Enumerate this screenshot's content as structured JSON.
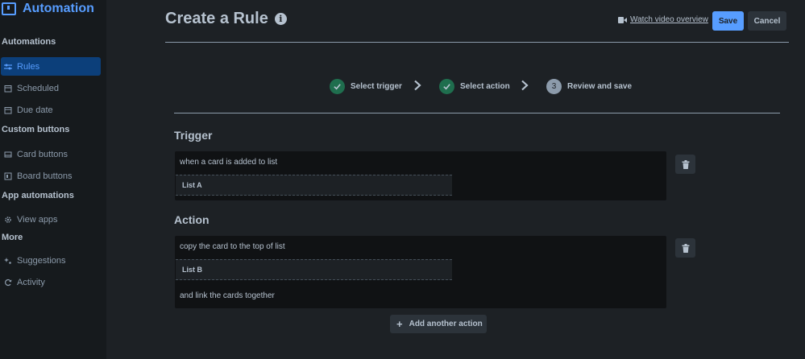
{
  "app": {
    "title": "Automation"
  },
  "sidebar": {
    "sections": [
      {
        "heading": "Automations",
        "items": [
          {
            "label": "Rules",
            "icon": "sliders-icon",
            "active": true
          },
          {
            "label": "Scheduled",
            "icon": "calendar-icon"
          },
          {
            "label": "Due date",
            "icon": "calendar-icon"
          }
        ]
      },
      {
        "heading": "Custom buttons",
        "items": [
          {
            "label": "Card buttons",
            "icon": "card-icon"
          },
          {
            "label": "Board buttons",
            "icon": "board-icon"
          }
        ]
      },
      {
        "heading": "App automations",
        "items": [
          {
            "label": "View apps",
            "icon": "gear-icon"
          }
        ]
      },
      {
        "heading": "More",
        "items": [
          {
            "label": "Suggestions",
            "icon": "sparkle-icon"
          },
          {
            "label": "Activity",
            "icon": "refresh-icon"
          }
        ]
      }
    ]
  },
  "header": {
    "title": "Create a Rule",
    "info_glyph": "i",
    "video_link": "Watch video overview",
    "save_label": "Save",
    "cancel_label": "Cancel"
  },
  "steps": [
    {
      "label": "Select trigger",
      "state": "done"
    },
    {
      "label": "Select action",
      "state": "done"
    },
    {
      "label": "Review and save",
      "state": "current",
      "number": "3"
    }
  ],
  "trigger": {
    "title": "Trigger",
    "text": "when a card is added to list",
    "list": "List A"
  },
  "action": {
    "title": "Action",
    "text": "copy the card to the top of list",
    "list": "List B",
    "suffix": "and link the cards together",
    "add_label": "Add another action"
  },
  "colors": {
    "background": "#1d2125",
    "sidebar": "#161a1d",
    "accent": "#579dff",
    "success": "#1f6e4e",
    "card": "#101214"
  }
}
